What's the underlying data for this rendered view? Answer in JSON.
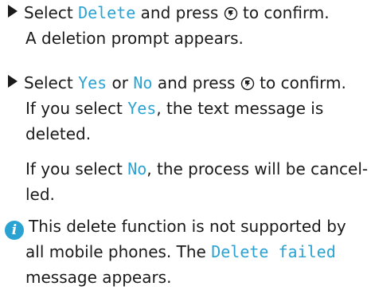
{
  "step1": {
    "pre": "Select ",
    "hl": "Delete",
    "post": " and press ",
    "post2": " to confirm.",
    "result": "A deletion prompt appears."
  },
  "step2": {
    "pre": "Select ",
    "yes": "Yes",
    "or": " or ",
    "no": "No",
    "post": " and press ",
    "post2": " to confirm.",
    "r1_pre": "If you select ",
    "r1_hl": "Yes",
    "r1_post": ", the text message is",
    "r1_cont": "deleted.",
    "r2_pre": "If you select ",
    "r2_hl": "No",
    "r2_post": ", the process will be cancel-",
    "r2_cont": "led."
  },
  "note": {
    "l1": "This delete function is not supported by",
    "l2_pre": "all mobile phones. The ",
    "l2_hl": "Delete failed",
    "l3": "message appears."
  },
  "icons": {
    "bullet": "triangle-bullet-icon",
    "knob": "controller-press-icon",
    "info": "info-icon"
  },
  "colors": {
    "highlight": "#2aa3d3",
    "text": "#1a1a1a"
  }
}
